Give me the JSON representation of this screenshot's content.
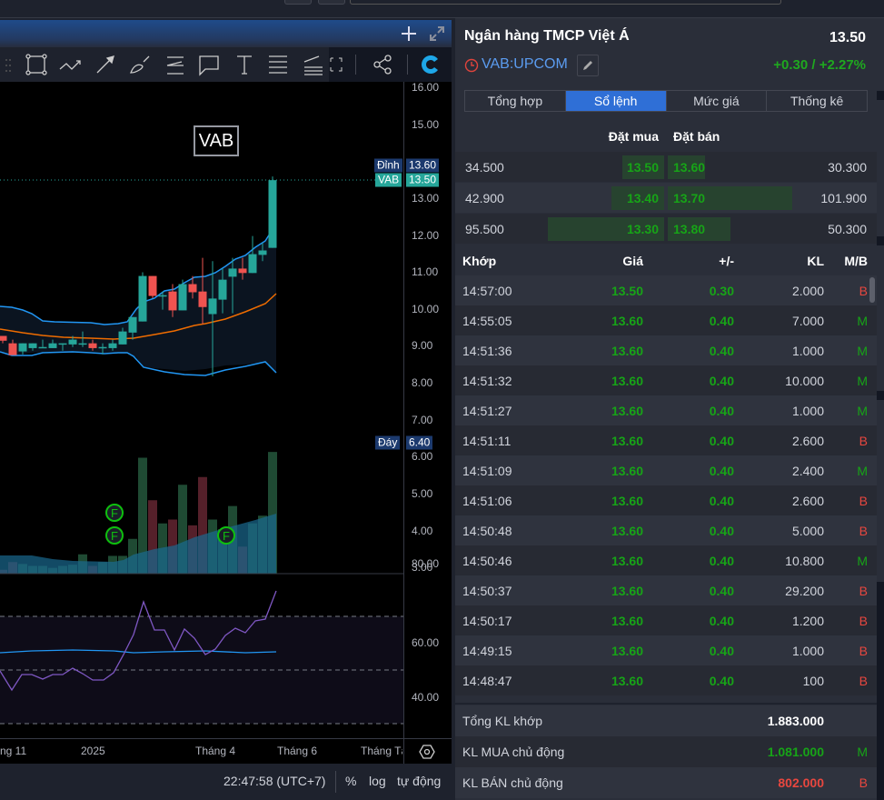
{
  "chart_header": {
    "add_icon": "plus-icon",
    "expand_icon": "expand-icon"
  },
  "chart": {
    "symbol_label": "VAB",
    "price_axis": [
      "16.00",
      "15.00",
      "14.00",
      "13.00",
      "12.00",
      "11.00",
      "10.00",
      "9.00",
      "8.00",
      "7.00",
      "6.00",
      "5.00",
      "4.00",
      "3.00"
    ],
    "high_tag": {
      "label": "Đỉnh",
      "value": "13.60"
    },
    "last_tag": {
      "label": "VAB",
      "value": "13.50"
    },
    "low_tag": {
      "label": "Đáy",
      "value": "6.40"
    },
    "rsi_axis": [
      "80.00",
      "60.00",
      "40.00"
    ],
    "time_axis": [
      "ng 11",
      "2025",
      "Tháng 4",
      "Tháng 6",
      "Tháng Tá"
    ],
    "marker_label": "F",
    "candles": [
      [
        9.28,
        9.28,
        9.08,
        9.15
      ],
      [
        9.08,
        9.18,
        8.76,
        8.76
      ],
      [
        8.86,
        9.08,
        8.78,
        9.08
      ],
      [
        8.95,
        9.08,
        8.88,
        9.08
      ],
      [
        8.98,
        9.18,
        8.98,
        8.98
      ],
      [
        8.95,
        9.18,
        8.95,
        9.08
      ],
      [
        9.08,
        9.08,
        8.88,
        9.08
      ],
      [
        9.05,
        9.28,
        8.98,
        9.18
      ],
      [
        9.08,
        9.4,
        8.98,
        9.08
      ],
      [
        9.08,
        9.18,
        8.88,
        8.95
      ],
      [
        8.98,
        9.08,
        8.78,
        8.98
      ],
      [
        8.95,
        9.18,
        8.88,
        9.08
      ],
      [
        9.05,
        9.5,
        9.05,
        9.4
      ],
      [
        9.37,
        9.79,
        9.18,
        9.79
      ],
      [
        9.67,
        11.0,
        9.67,
        10.9
      ],
      [
        10.9,
        10.9,
        10.3,
        10.36
      ],
      [
        10.38,
        10.48,
        9.99,
        10.38
      ],
      [
        10.48,
        10.68,
        9.79,
        9.97
      ],
      [
        9.97,
        10.8,
        9.97,
        10.68
      ],
      [
        10.68,
        10.9,
        10.29,
        10.46
      ],
      [
        10.48,
        11.39,
        9.6,
        10.06
      ],
      [
        9.87,
        11.3,
        8.19,
        10.29
      ],
      [
        10.26,
        11.1,
        9.89,
        10.8
      ],
      [
        10.88,
        11.39,
        9.89,
        11.1
      ],
      [
        11.1,
        11.39,
        10.8,
        10.98
      ],
      [
        10.98,
        11.98,
        10.98,
        11.49
      ],
      [
        11.47,
        11.79,
        11.3,
        11.59
      ],
      [
        11.66,
        13.59,
        11.66,
        13.49
      ]
    ],
    "volume": [
      1,
      3,
      2.5,
      2,
      2,
      1.5,
      2,
      2.3,
      5,
      2,
      3,
      4.6,
      4.6,
      9,
      30,
      19,
      13,
      14,
      23,
      12.5,
      25,
      14,
      11.5,
      17.5,
      7,
      13,
      15,
      31.5
    ],
    "colors": {
      "up": "#26a69a",
      "down": "#ef5350",
      "rsi": "#7e57c2",
      "bb": "#2196f3",
      "ma": "#ef6c00"
    }
  },
  "status": {
    "time": "22:47:58 (UTC+7)",
    "percent": "%",
    "log": "log",
    "auto": "tự động"
  },
  "panel": {
    "title": "Ngân hàng TMCP Việt Á",
    "price": "13.50",
    "symbol": "VAB:UPCOM",
    "change": "+0.30 / +2.27%",
    "tabs": [
      "Tổng hợp",
      "Sổ lệnh",
      "Mức giá",
      "Thống kê"
    ],
    "orderbook_headers": {
      "buy": "Đặt mua",
      "sell": "Đặt bán"
    },
    "orderbook": [
      {
        "buy_vol": "34.500",
        "buy": "13.50",
        "sell": "13.60",
        "sell_vol": "30.300",
        "buy_fill": 0.36,
        "sell_fill": 0.3
      },
      {
        "buy_vol": "42.900",
        "buy": "13.40",
        "sell": "13.70",
        "sell_vol": "101.900",
        "buy_fill": 0.45,
        "sell_fill": 1.0
      },
      {
        "buy_vol": "95.500",
        "buy": "13.30",
        "sell": "13.80",
        "sell_vol": "50.300",
        "buy_fill": 1.0,
        "sell_fill": 0.5
      }
    ],
    "trade_headers": [
      "Khớp",
      "Giá",
      "+/-",
      "KL",
      "M/B"
    ],
    "trades": [
      [
        "14:57:00",
        "13.50",
        "0.30",
        "2.000",
        "B"
      ],
      [
        "14:55:05",
        "13.60",
        "0.40",
        "7.000",
        "M"
      ],
      [
        "14:51:36",
        "13.60",
        "0.40",
        "1.000",
        "M"
      ],
      [
        "14:51:32",
        "13.60",
        "0.40",
        "10.000",
        "M"
      ],
      [
        "14:51:27",
        "13.60",
        "0.40",
        "1.000",
        "M"
      ],
      [
        "14:51:11",
        "13.60",
        "0.40",
        "2.600",
        "B"
      ],
      [
        "14:51:09",
        "13.60",
        "0.40",
        "2.400",
        "M"
      ],
      [
        "14:51:06",
        "13.60",
        "0.40",
        "2.600",
        "B"
      ],
      [
        "14:50:48",
        "13.60",
        "0.40",
        "5.000",
        "B"
      ],
      [
        "14:50:46",
        "13.60",
        "0.40",
        "10.800",
        "M"
      ],
      [
        "14:50:37",
        "13.60",
        "0.40",
        "29.200",
        "B"
      ],
      [
        "14:50:17",
        "13.60",
        "0.40",
        "1.200",
        "B"
      ],
      [
        "14:49:15",
        "13.60",
        "0.40",
        "1.000",
        "B"
      ],
      [
        "14:48:47",
        "13.60",
        "0.40",
        "100",
        "B"
      ]
    ],
    "summary": [
      {
        "label": "Tổng KL khớp",
        "value": "1.883.000",
        "side": ""
      },
      {
        "label": "KL MUA chủ động",
        "value": "1.081.000",
        "side": "M"
      },
      {
        "label": "KL BÁN chủ động",
        "value": "802.000",
        "side": "B"
      }
    ]
  }
}
